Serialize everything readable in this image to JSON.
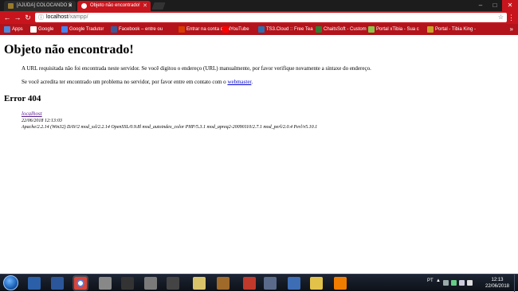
{
  "browser": {
    "tabs": [
      {
        "label": "[AJUDA] COLOCANDO S"
      },
      {
        "label": "Objeto não encontrado!"
      }
    ],
    "url_host": "localhost",
    "url_path": "/xampp/",
    "bookmarks": [
      {
        "label": "Apps",
        "color": "#4a89dc"
      },
      {
        "label": "Google",
        "color": "#ffffff"
      },
      {
        "label": "Google Tradutor",
        "color": "#4285f4"
      },
      {
        "label": "Facebook – entre ou",
        "color": "#3b5998"
      },
      {
        "label": "Entrar na conta da N",
        "color": "#d83b01"
      },
      {
        "label": "YouTube",
        "color": "#ff0000"
      },
      {
        "label": "TS3.Cloud :: Free Tea",
        "color": "#2a6fb0"
      },
      {
        "label": "ChaitsSoft - Custom",
        "color": "#2e7d32"
      },
      {
        "label": "Portal xTibia - Sua c",
        "color": "#8bc34a"
      },
      {
        "label": "Portal - Tibia King -",
        "color": "#c9a227"
      }
    ]
  },
  "page": {
    "title": "Objeto não encontrado!",
    "paragraph1": "A URL requisitada não foi encontrada neste servidor. Se você digitou o endereço (URL) manualmente, por favor verifique novamente a sintaxe do endereço.",
    "paragraph2_before": "Se você acredita ter encontrado um problema no servidor, por favor entre em contato com o ",
    "paragraph2_link": "webmaster",
    "paragraph2_after": ".",
    "error_heading": "Error 404",
    "address_host": "localhost",
    "address_date": "22/06/2018 12:13:03",
    "address_server": "Apache/2.2.14 (Win32) DAV/2 mod_ssl/2.2.14 OpenSSL/0.9.8l mod_autoindex_color PHP/5.3.1 mod_apreq2-20090110/2.7.1 mod_perl/2.0.4 Perl/v5.10.1"
  },
  "taskbar": {
    "language": "PT",
    "time": "12:13",
    "date": "22/06/2018"
  }
}
